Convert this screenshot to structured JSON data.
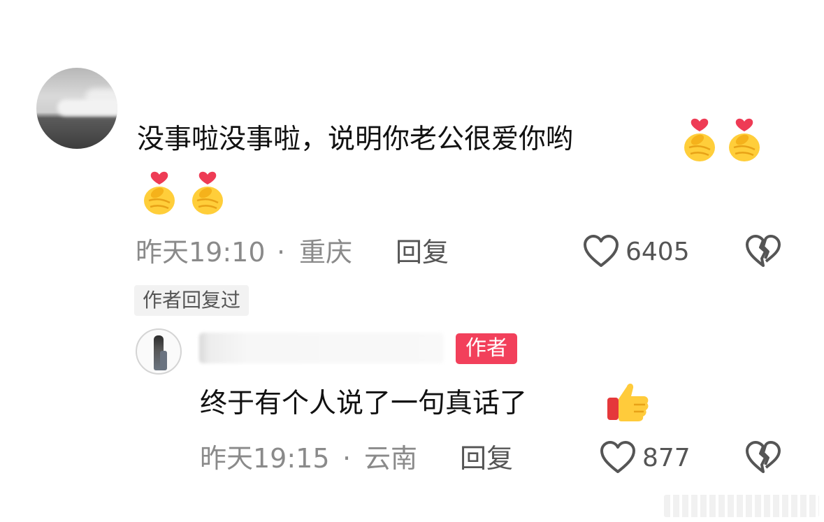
{
  "comment": {
    "text": "没事啦没事啦，说明你老公很爱你哟",
    "time": "昨天19:10",
    "location": "重庆",
    "reply_label": "回复",
    "likes": "6405",
    "emoji_icon": "finger-heart-icon"
  },
  "author_replied_tag": "作者回复过",
  "reply": {
    "author_badge": "作者",
    "text": "终于有个人说了一句真话了",
    "time": "昨天19:15",
    "location": "云南",
    "reply_label": "回复",
    "likes": "877",
    "emoji_icon": "thumbs-up-icon"
  },
  "separator": "·",
  "colors": {
    "author_badge_bg": "#f2405b",
    "meta_gray": "#8a8a8a",
    "text_dark": "#111111"
  }
}
